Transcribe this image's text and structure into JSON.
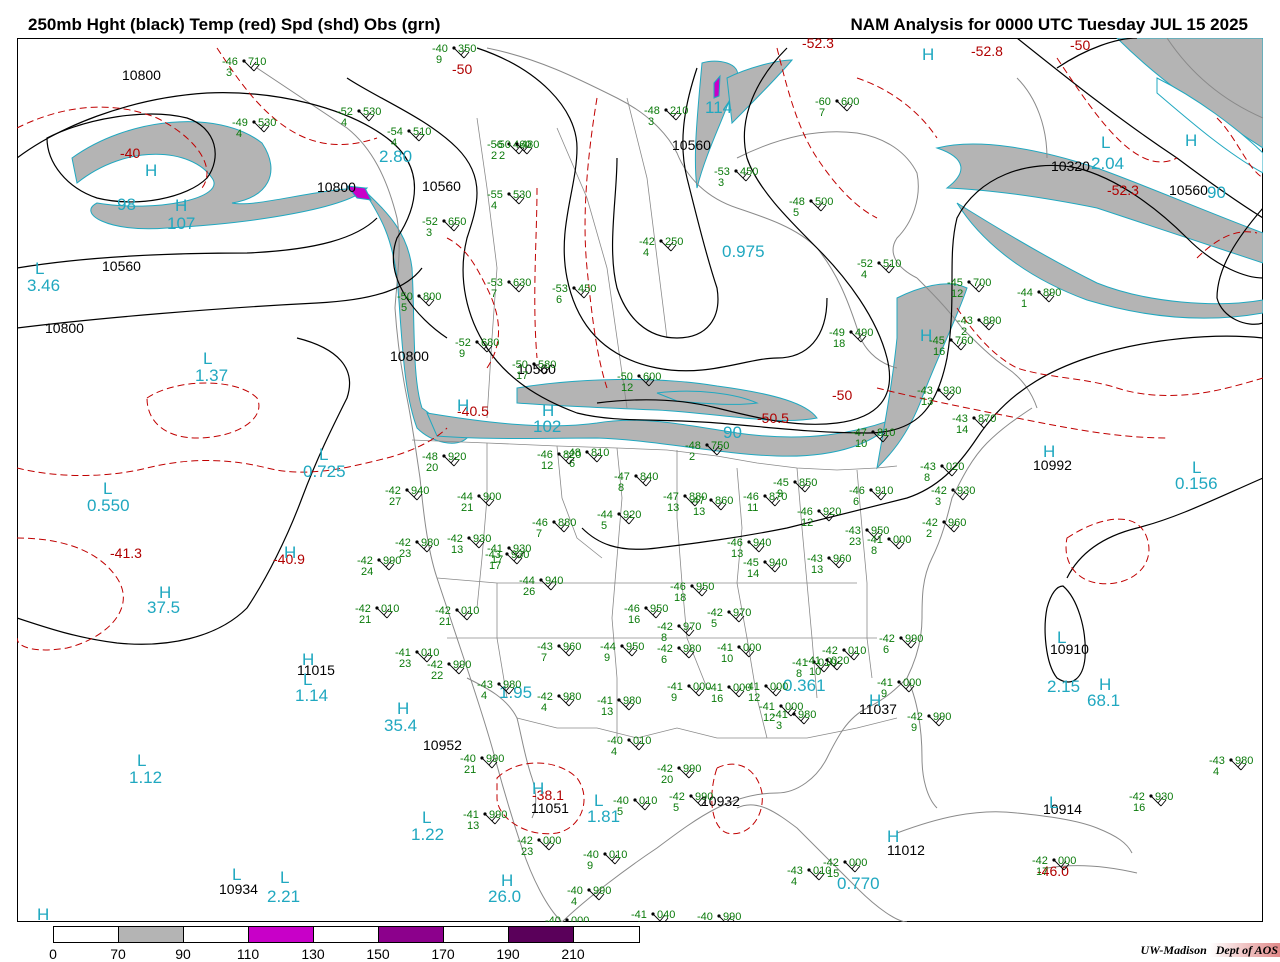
{
  "header": {
    "left_title": "250mb Hght (black) Temp (red) Spd (shd) Obs (grn)",
    "right_title": "NAM Analysis for 0000 UTC Tuesday  JUL 15 2025"
  },
  "legend": {
    "ticks": [
      "0",
      "70",
      "90",
      "110",
      "130",
      "150",
      "170",
      "190",
      "210"
    ],
    "bins": [
      {
        "from": 0,
        "to": 70,
        "color": "#ffffff"
      },
      {
        "from": 70,
        "to": 90,
        "color": "#b4b4b4"
      },
      {
        "from": 90,
        "to": 110,
        "color": "#ffffff"
      },
      {
        "from": 110,
        "to": 130,
        "color": "#c800c8"
      },
      {
        "from": 130,
        "to": 150,
        "color": "#ffffff"
      },
      {
        "from": 150,
        "to": 170,
        "color": "#8c008c"
      },
      {
        "from": 170,
        "to": 190,
        "color": "#ffffff"
      },
      {
        "from": 190,
        "to": 210,
        "color": "#5a005a"
      }
    ]
  },
  "credit": {
    "org": "UW-Madison",
    "dept": "Dept of AOS"
  },
  "colors": {
    "height_contours": "#000000",
    "temperature_contours": "#c00000",
    "speed_shading": "#b4b4b4",
    "speed_labels": "#20a8c0",
    "observations": "#0a7a0a",
    "map_lines": "#808080"
  },
  "height_labels": [
    "10800",
    "10560",
    "10560",
    "10800",
    "10800",
    "10800",
    "10560",
    "10320",
    "10560",
    "10560",
    "10992",
    "11015",
    "10952",
    "11051",
    "10932",
    "11037",
    "11012",
    "10910",
    "10934",
    "10914"
  ],
  "temperature_labels": [
    "-40",
    "-41.3",
    "-40.9",
    "-40.5",
    "-52.3",
    "-52.8",
    "-50",
    "-50",
    "-52.3",
    "-50.5",
    "-50",
    "-38.1",
    "-46.0"
  ],
  "speed_labels": [
    "3.46",
    "1.37",
    "0.725",
    "0.550",
    "37.5",
    "1.14",
    "35.4",
    "1.12",
    "1.22",
    "2.21",
    "26.0",
    "1.81",
    "1.95",
    "0.361",
    "0.770",
    "2.15",
    "68.1",
    "0.156",
    "2.04",
    "0.975",
    "102",
    "90",
    "107",
    "98",
    "114",
    "2.80",
    "90"
  ],
  "hl_markers": [
    "H",
    "L"
  ],
  "observations": [
    {
      "t": "-46",
      "h": "710",
      "d": "3"
    },
    {
      "t": "-49",
      "h": "530",
      "d": "4"
    },
    {
      "t": "-52",
      "h": "530",
      "d": "4"
    },
    {
      "t": "-54",
      "h": "510",
      "d": "4"
    },
    {
      "t": "-56",
      "h": "460",
      "d": "2"
    },
    {
      "t": "-55",
      "h": "530",
      "d": "4"
    },
    {
      "t": "-53",
      "h": "630",
      "d": "7"
    },
    {
      "t": "-53",
      "h": "450",
      "d": "6"
    },
    {
      "t": "-50",
      "h": "800",
      "d": "5"
    },
    {
      "t": "-52",
      "h": "680",
      "d": "9"
    },
    {
      "t": "-50",
      "h": "580",
      "d": "17"
    },
    {
      "t": "-50",
      "h": "600",
      "d": "12"
    },
    {
      "t": "-48",
      "h": "750",
      "d": "2"
    },
    {
      "t": "-48",
      "h": "810",
      "d": "6"
    },
    {
      "t": "-46",
      "h": "820",
      "d": "12"
    },
    {
      "t": "-48",
      "h": "920",
      "d": "20"
    },
    {
      "t": "-42",
      "h": "940",
      "d": "27"
    },
    {
      "t": "-44",
      "h": "900",
      "d": "21"
    },
    {
      "t": "-42",
      "h": "980",
      "d": "23"
    },
    {
      "t": "-42",
      "h": "930",
      "d": "13"
    },
    {
      "t": "-41",
      "h": "930",
      "d": "17"
    },
    {
      "t": "-46",
      "h": "880",
      "d": "7"
    },
    {
      "t": "-44",
      "h": "920",
      "d": "5"
    },
    {
      "t": "-47",
      "h": "840",
      "d": "8"
    },
    {
      "t": "-47",
      "h": "880",
      "d": "13"
    },
    {
      "t": "-47",
      "h": "860",
      "d": "13"
    },
    {
      "t": "-46",
      "h": "870",
      "d": "11"
    },
    {
      "t": "-45",
      "h": "850",
      "d": "9"
    },
    {
      "t": "-46",
      "h": "920",
      "d": "12"
    },
    {
      "t": "-46",
      "h": "910",
      "d": "6"
    },
    {
      "t": "-43",
      "h": "950",
      "d": "23"
    },
    {
      "t": "-42",
      "h": "990",
      "d": "24"
    },
    {
      "t": "-44",
      "h": "940",
      "d": "26"
    },
    {
      "t": "-43",
      "h": "930",
      "d": "17"
    },
    {
      "t": "-46",
      "h": "940",
      "d": "13"
    },
    {
      "t": "-45",
      "h": "940",
      "d": "14"
    },
    {
      "t": "-43",
      "h": "960",
      "d": "13"
    },
    {
      "t": "-41",
      "h": "000",
      "d": "8"
    },
    {
      "t": "-42",
      "h": "010",
      "d": "21"
    },
    {
      "t": "-42",
      "h": "010",
      "d": "21"
    },
    {
      "t": "-46",
      "h": "950",
      "d": "18"
    },
    {
      "t": "-46",
      "h": "950",
      "d": "16"
    },
    {
      "t": "-42",
      "h": "970",
      "d": "5"
    },
    {
      "t": "-42",
      "h": "970",
      "d": "8"
    },
    {
      "t": "-41",
      "h": "010",
      "d": "23"
    },
    {
      "t": "-42",
      "h": "990",
      "d": "22"
    },
    {
      "t": "-43",
      "h": "960",
      "d": "7"
    },
    {
      "t": "-44",
      "h": "950",
      "d": "9"
    },
    {
      "t": "-42",
      "h": "980",
      "d": "6"
    },
    {
      "t": "-41",
      "h": "000",
      "d": "10"
    },
    {
      "t": "-41",
      "h": "010",
      "d": "8"
    },
    {
      "t": "-42",
      "h": "010",
      "d": "9"
    },
    {
      "t": "-41",
      "h": "020",
      "d": "10"
    },
    {
      "t": "-43",
      "h": "980",
      "d": "4"
    },
    {
      "t": "-42",
      "h": "980",
      "d": "4"
    },
    {
      "t": "-41",
      "h": "980",
      "d": "13"
    },
    {
      "t": "-41",
      "h": "000",
      "d": "9"
    },
    {
      "t": "-41",
      "h": "000",
      "d": "16"
    },
    {
      "t": "-41",
      "h": "000",
      "d": "12"
    },
    {
      "t": "-41",
      "h": "000",
      "d": "9"
    },
    {
      "t": "-42",
      "h": "990",
      "d": "6"
    },
    {
      "t": "-42",
      "h": "990",
      "d": "9"
    },
    {
      "t": "-41",
      "h": "000",
      "d": "12"
    },
    {
      "t": "-41",
      "h": "980",
      "d": "3"
    },
    {
      "t": "-40",
      "h": "010",
      "d": "4"
    },
    {
      "t": "-42",
      "h": "990",
      "d": "20"
    },
    {
      "t": "-42",
      "h": "990",
      "d": "5"
    },
    {
      "t": "-40",
      "h": "010",
      "d": "5"
    },
    {
      "t": "-40",
      "h": "990",
      "d": "21"
    },
    {
      "t": "-41",
      "h": "990",
      "d": "13"
    },
    {
      "t": "-42",
      "h": "000",
      "d": "23"
    },
    {
      "t": "-40",
      "h": "010",
      "d": "9"
    },
    {
      "t": "-40",
      "h": "990",
      "d": "4"
    },
    {
      "t": "-40",
      "h": "000",
      "d": "4"
    },
    {
      "t": "-41",
      "h": "040",
      "d": "4"
    },
    {
      "t": "-40",
      "h": "990",
      "d": "3"
    },
    {
      "t": "-43",
      "h": "010",
      "d": "4"
    },
    {
      "t": "-42",
      "h": "000",
      "d": "15"
    },
    {
      "t": "-42",
      "h": "000",
      "d": "17"
    },
    {
      "t": "-42",
      "h": "930",
      "d": "16"
    },
    {
      "t": "-43",
      "h": "980",
      "d": "4"
    },
    {
      "t": "-43",
      "h": "020",
      "d": "8"
    },
    {
      "t": "-42",
      "h": "930",
      "d": "3"
    },
    {
      "t": "-42",
      "h": "960",
      "d": "2"
    },
    {
      "t": "-43",
      "h": "930",
      "d": "13"
    },
    {
      "t": "-43",
      "h": "870",
      "d": "14"
    },
    {
      "t": "-45",
      "h": "760",
      "d": "16"
    },
    {
      "t": "-45",
      "h": "700",
      "d": "12"
    },
    {
      "t": "-44",
      "h": "890",
      "d": "1"
    },
    {
      "t": "-43",
      "h": "890",
      "d": "2"
    },
    {
      "t": "-47",
      "h": "810",
      "d": "10"
    },
    {
      "t": "-49",
      "h": "490",
      "d": "18"
    },
    {
      "t": "-52",
      "h": "510",
      "d": "4"
    },
    {
      "t": "-48",
      "h": "500",
      "d": "5"
    },
    {
      "t": "-53",
      "h": "450",
      "d": "3"
    },
    {
      "t": "-42",
      "h": "250",
      "d": "4"
    },
    {
      "t": "-48",
      "h": "210",
      "d": "3"
    },
    {
      "t": "-60",
      "h": "600",
      "d": "7"
    },
    {
      "t": "-50",
      "h": "480",
      "d": "2"
    },
    {
      "t": "-40",
      "h": "350",
      "d": "9"
    },
    {
      "t": "-52",
      "h": "650",
      "d": "3"
    }
  ]
}
